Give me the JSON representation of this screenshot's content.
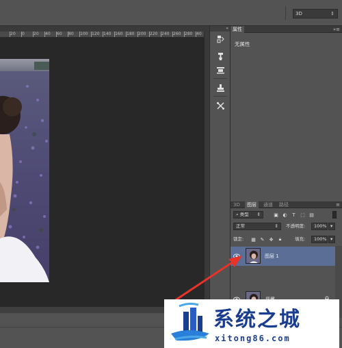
{
  "options_bar": {
    "mode_select": "3D"
  },
  "ruler": {
    "marks": [
      "20",
      "0",
      "20",
      "40",
      "60",
      "80",
      "100",
      "120",
      "140",
      "160",
      "180",
      "200",
      "220",
      "240",
      "260",
      "280",
      "40"
    ]
  },
  "properties_panel": {
    "tab_label": "属性",
    "content": "无属性"
  },
  "layers_panel": {
    "tabs": [
      "3D",
      "图层",
      "通道",
      "路径"
    ],
    "active_tab": "图层",
    "filter_kind": "类型",
    "blend_mode": "正常",
    "opacity_label": "不透明度:",
    "opacity_value": "100%",
    "lock_label": "锁定:",
    "fill_label": "填充:",
    "fill_value": "100%",
    "layers": [
      {
        "name": "图层 1",
        "selected": true
      },
      {
        "name": "背景",
        "selected": false,
        "locked": true
      }
    ]
  },
  "watermark": {
    "title": "系统之城",
    "url": "xitong86.com"
  },
  "colors": {
    "selection": "#5a6e96",
    "annotation_arrow": "#e8332a",
    "watermark_blue": "#1b3d8f"
  }
}
